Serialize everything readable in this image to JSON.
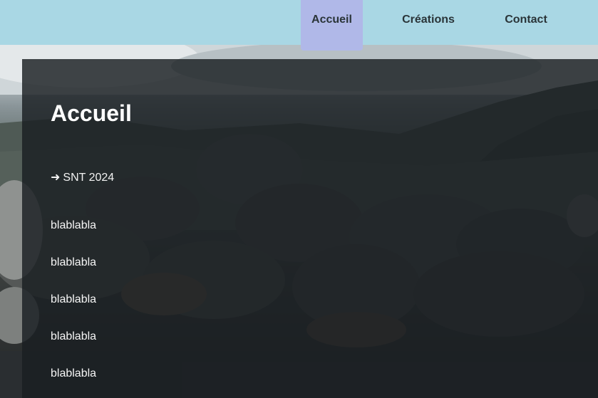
{
  "nav": {
    "items": [
      {
        "label": "Accueil",
        "active": true
      },
      {
        "label": "Créations",
        "active": false
      },
      {
        "label": "Contact",
        "active": false
      }
    ]
  },
  "main": {
    "title": "Accueil",
    "link": {
      "arrow": "➜",
      "label": "SNT 2024"
    },
    "paragraphs": [
      "blablabla",
      "blablabla",
      "blablabla",
      "blablabla",
      "blablabla"
    ]
  },
  "colors": {
    "header_bg": "#a9d7e4",
    "active_tab_bg": "#b0b8e8",
    "panel_bg": "#1a1e22"
  }
}
